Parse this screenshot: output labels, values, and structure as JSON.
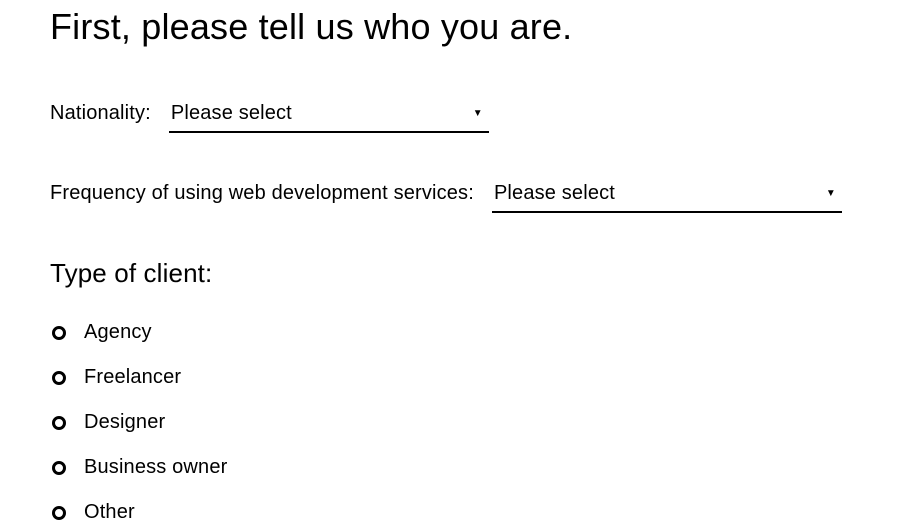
{
  "heading": "First, please tell us who you are.",
  "fields": {
    "nationality": {
      "label": "Nationality:",
      "selected": "Please select"
    },
    "frequency": {
      "label": "Frequency of using web development services:",
      "selected": "Please select"
    }
  },
  "clientType": {
    "label": "Type of client:",
    "options": [
      "Agency",
      "Freelancer",
      "Designer",
      "Business owner",
      "Other"
    ]
  }
}
